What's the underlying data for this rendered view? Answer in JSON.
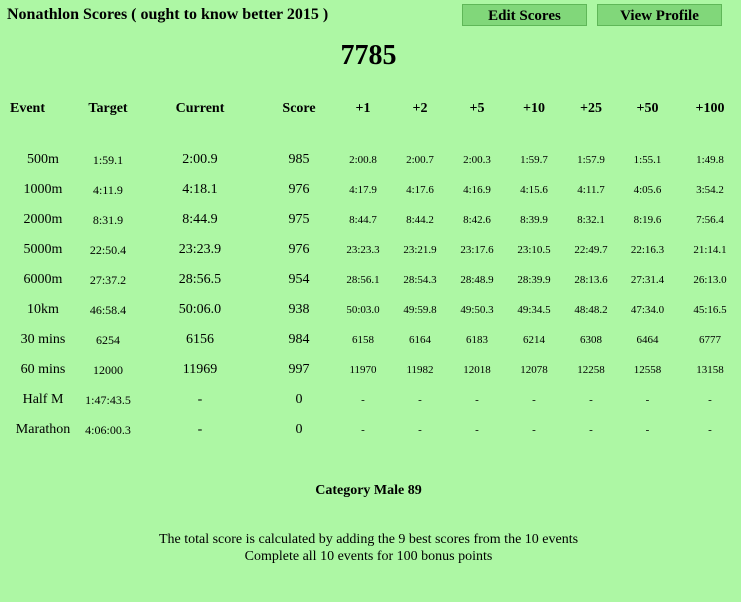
{
  "header": {
    "title": "Nonathlon Scores ( ought to know better 2015 )",
    "edit_scores_label": "Edit  Scores",
    "view_profile_label": "View  Profile"
  },
  "total_score": "7785",
  "table": {
    "columns": [
      "Event",
      "Target",
      "Current",
      "Score",
      "+1",
      "+2",
      "+5",
      "+10",
      "+25",
      "+50",
      "+100"
    ],
    "rows": [
      {
        "event": "500m",
        "target": "1:59.1",
        "current": "2:00.9",
        "score": "985",
        "increments": [
          "2:00.8",
          "2:00.7",
          "2:00.3",
          "1:59.7",
          "1:57.9",
          "1:55.1",
          "1:49.8"
        ]
      },
      {
        "event": "1000m",
        "target": "4:11.9",
        "current": "4:18.1",
        "score": "976",
        "increments": [
          "4:17.9",
          "4:17.6",
          "4:16.9",
          "4:15.6",
          "4:11.7",
          "4:05.6",
          "3:54.2"
        ]
      },
      {
        "event": "2000m",
        "target": "8:31.9",
        "current": "8:44.9",
        "score": "975",
        "increments": [
          "8:44.7",
          "8:44.2",
          "8:42.6",
          "8:39.9",
          "8:32.1",
          "8:19.6",
          "7:56.4"
        ]
      },
      {
        "event": "5000m",
        "target": "22:50.4",
        "current": "23:23.9",
        "score": "976",
        "increments": [
          "23:23.3",
          "23:21.9",
          "23:17.6",
          "23:10.5",
          "22:49.7",
          "22:16.3",
          "21:14.1"
        ]
      },
      {
        "event": "6000m",
        "target": "27:37.2",
        "current": "28:56.5",
        "score": "954",
        "increments": [
          "28:56.1",
          "28:54.3",
          "28:48.9",
          "28:39.9",
          "28:13.6",
          "27:31.4",
          "26:13.0"
        ]
      },
      {
        "event": "10km",
        "target": "46:58.4",
        "current": "50:06.0",
        "score": "938",
        "increments": [
          "50:03.0",
          "49:59.8",
          "49:50.3",
          "49:34.5",
          "48:48.2",
          "47:34.0",
          "45:16.5"
        ]
      },
      {
        "event": "30 mins",
        "target": "6254",
        "current": "6156",
        "score": "984",
        "increments": [
          "6158",
          "6164",
          "6183",
          "6214",
          "6308",
          "6464",
          "6777"
        ]
      },
      {
        "event": "60 mins",
        "target": "12000",
        "current": "11969",
        "score": "997",
        "increments": [
          "11970",
          "11982",
          "12018",
          "12078",
          "12258",
          "12558",
          "13158"
        ]
      },
      {
        "event": "Half M",
        "target": "1:47:43.5",
        "current": "-",
        "score": "0",
        "increments": [
          "-",
          "-",
          "-",
          "-",
          "-",
          "-",
          "-"
        ]
      },
      {
        "event": "Marathon",
        "target": "4:06:00.3",
        "current": "-",
        "score": "0",
        "increments": [
          "-",
          "-",
          "-",
          "-",
          "-",
          "-",
          "-"
        ]
      }
    ]
  },
  "category": "Category  Male  89",
  "notes": [
    "The total score is calculated by adding the 9 best scores from the 10 events",
    "Complete all 10 events for 100 bonus points"
  ]
}
